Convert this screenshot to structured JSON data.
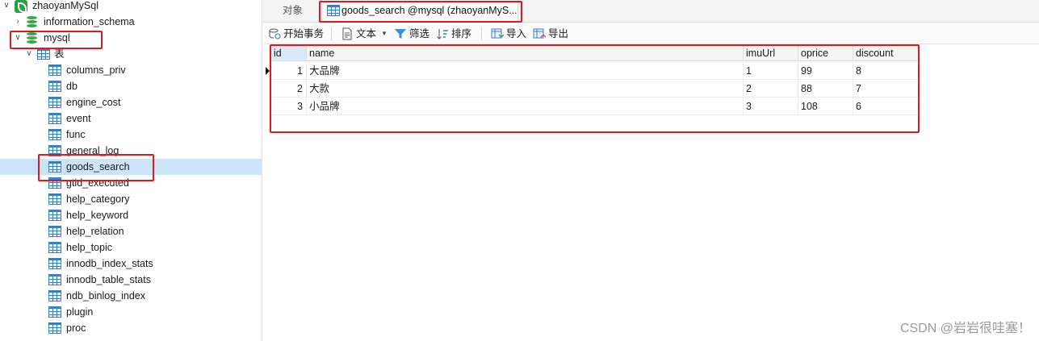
{
  "sidebar": {
    "connection": "zhaoyanMySql",
    "databases": [
      "information_schema",
      "mysql"
    ],
    "tables_folder": "表",
    "tables": [
      "columns_priv",
      "db",
      "engine_cost",
      "event",
      "func",
      "general_log",
      "goods_search",
      "gtid_executed",
      "help_category",
      "help_keyword",
      "help_relation",
      "help_topic",
      "innodb_index_stats",
      "innodb_table_stats",
      "ndb_binlog_index",
      "plugin",
      "proc"
    ],
    "selected_table": "goods_search"
  },
  "tabs": {
    "objects": "对象",
    "active": "goods_search @mysql (zhaoyanMyS..."
  },
  "toolbar": {
    "begin_transaction": "开始事务",
    "text": "文本",
    "filter": "筛选",
    "sort": "排序",
    "import": "导入",
    "export": "导出"
  },
  "grid": {
    "columns": [
      "id",
      "name",
      "imuUrl",
      "oprice",
      "discount"
    ],
    "rows": [
      [
        "1",
        "大品牌",
        "1",
        "99",
        "8"
      ],
      [
        "2",
        "大款",
        "2",
        "88",
        "7"
      ],
      [
        "3",
        "小品牌",
        "3",
        "108",
        "6"
      ]
    ]
  },
  "watermark": "CSDN @岩岩很哇塞！",
  "colors": {
    "highlight": "#e0191f",
    "selection": "#cce4f7",
    "db_green": "#35a84a",
    "table_blue": "#3a7fc1"
  }
}
